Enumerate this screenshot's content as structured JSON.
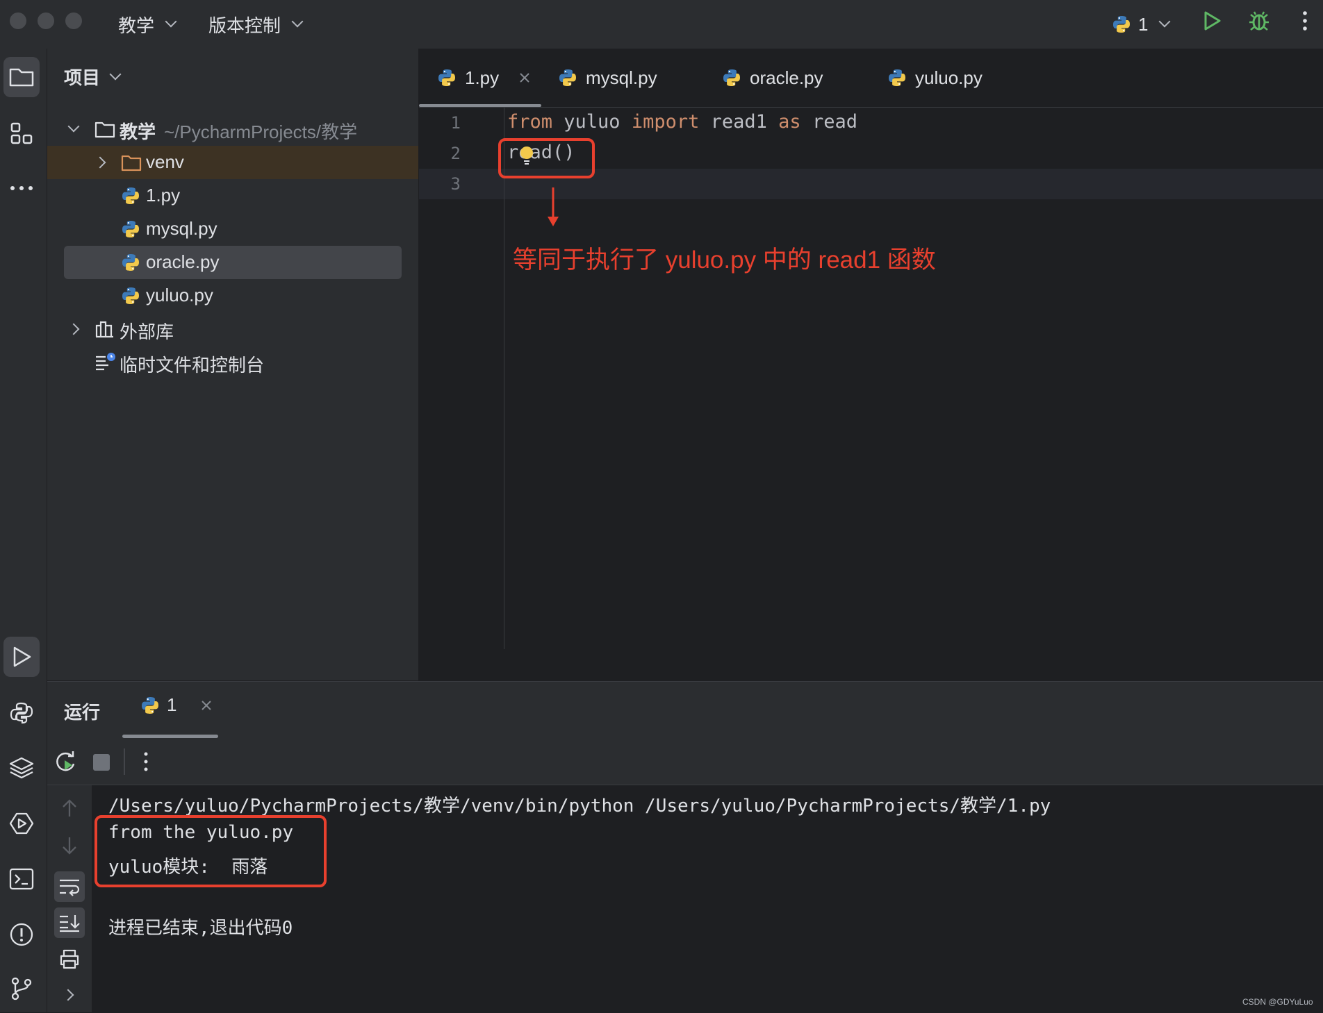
{
  "titlebar": {
    "menu_project": "教学",
    "menu_vcs": "版本控制",
    "run_config": "1"
  },
  "project_panel": {
    "title": "项目",
    "root_name": "教学",
    "root_path": "~/PycharmProjects/教学",
    "items": [
      {
        "label": "venv"
      },
      {
        "label": "1.py"
      },
      {
        "label": "mysql.py"
      },
      {
        "label": "oracle.py"
      },
      {
        "label": "yuluo.py"
      }
    ],
    "external_libs": "外部库",
    "scratches": "临时文件和控制台"
  },
  "editor": {
    "tabs": [
      {
        "label": "1.py"
      },
      {
        "label": "mysql.py"
      },
      {
        "label": "oracle.py"
      },
      {
        "label": "yuluo.py"
      }
    ],
    "line_numbers": [
      "1",
      "2",
      "3"
    ],
    "line1": {
      "kw1": "from",
      "t1": " yuluo ",
      "kw2": "import",
      "t2": " read1 ",
      "kw3": "as",
      "t3": " read"
    },
    "line2": "read()",
    "annotation": "等同于执行了 yuluo.py 中的 read1 函数"
  },
  "run_panel": {
    "title": "运行",
    "tab_label": "1",
    "output": [
      "/Users/yuluo/PycharmProjects/教学/venv/bin/python /Users/yuluo/PycharmProjects/教学/1.py",
      "from the yuluo.py",
      "yuluo模块:  雨落",
      "",
      "进程已结束,退出代码0"
    ]
  },
  "watermark": "CSDN @GDYuLuo",
  "colors": {
    "background": "#1e1f22",
    "panel": "#2b2d30",
    "keyword": "#cf8e6d",
    "annotation_red": "#e8402e",
    "run_green": "#5fb865"
  }
}
